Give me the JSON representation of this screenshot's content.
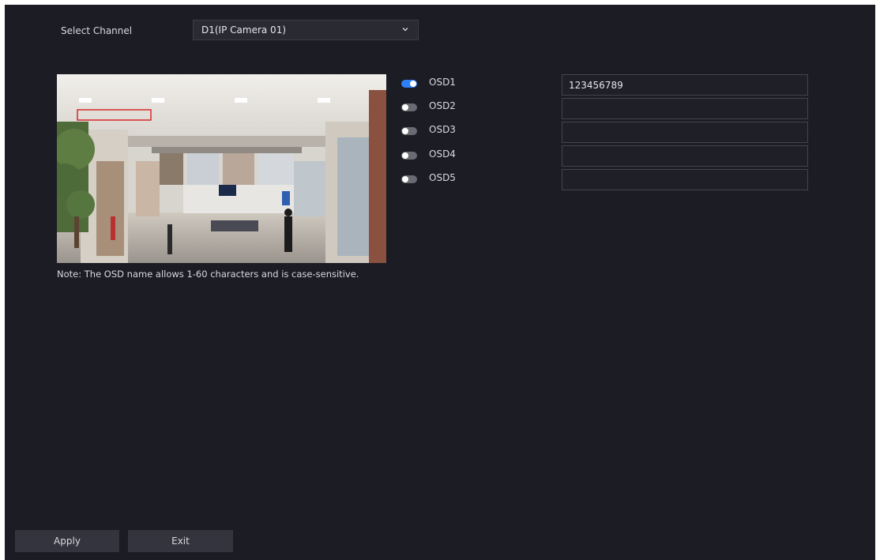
{
  "channel": {
    "label": "Select Channel",
    "selected": "D1(IP Camera 01)"
  },
  "osd": [
    {
      "label": "OSD1",
      "enabled": true,
      "value": "123456789"
    },
    {
      "label": "OSD2",
      "enabled": false,
      "value": ""
    },
    {
      "label": "OSD3",
      "enabled": false,
      "value": ""
    },
    {
      "label": "OSD4",
      "enabled": false,
      "value": ""
    },
    {
      "label": "OSD5",
      "enabled": false,
      "value": ""
    }
  ],
  "note": "Note: The OSD name allows 1-60 characters and is case-sensitive.",
  "buttons": {
    "apply": "Apply",
    "exit": "Exit"
  },
  "colors": {
    "background": "#1c1c24",
    "toggle_on": "#2f7ff5",
    "toggle_off": "#6a6a72",
    "osd_box": "#d42a2a"
  },
  "icons": {
    "dropdown": "chevron-down-icon"
  }
}
